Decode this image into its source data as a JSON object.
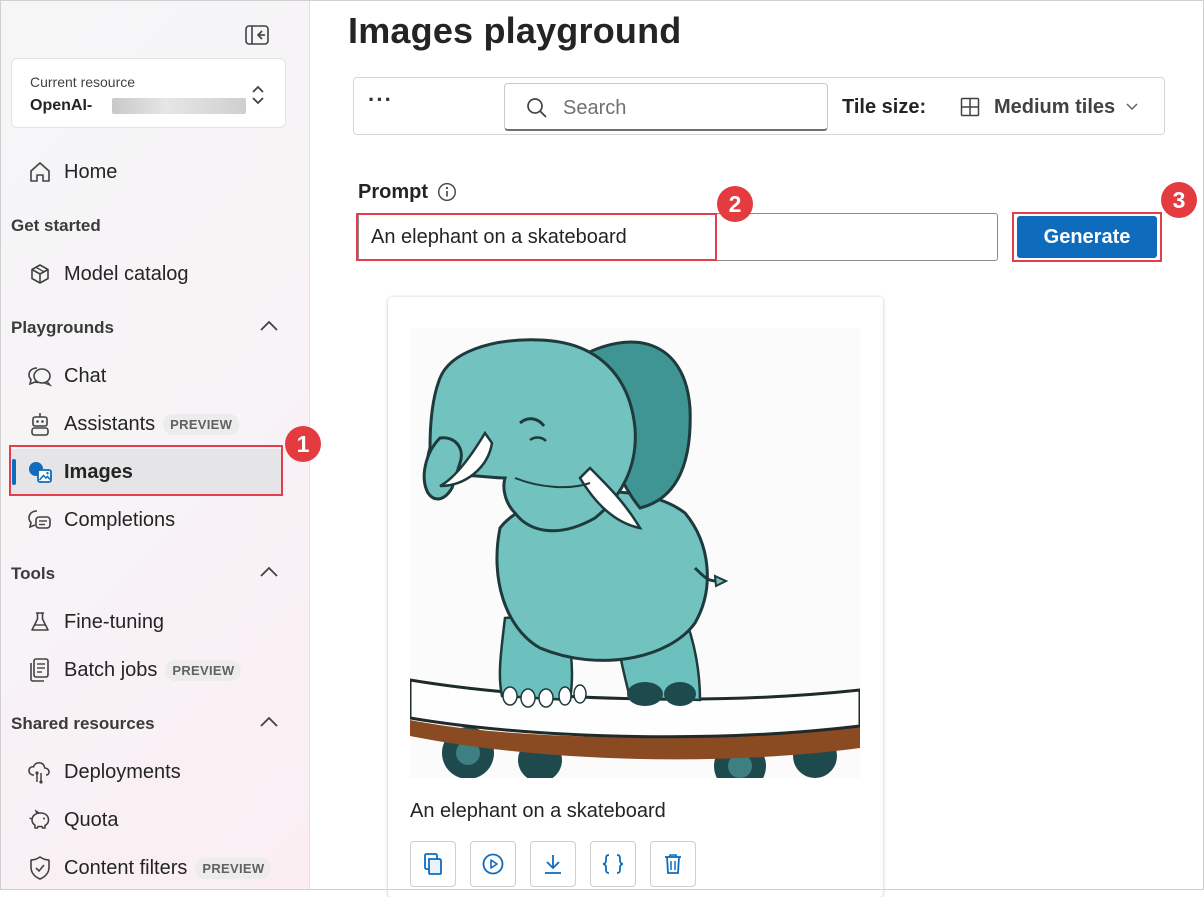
{
  "sidebar": {
    "resource": {
      "label": "Current resource",
      "name": "OpenAI-"
    },
    "home": "Home",
    "sections": {
      "get_started": "Get started",
      "playgrounds": "Playgrounds",
      "tools": "Tools",
      "shared_resources": "Shared resources"
    },
    "items": {
      "model_catalog": "Model catalog",
      "chat": "Chat",
      "assistants": "Assistants",
      "images": "Images",
      "completions": "Completions",
      "fine_tuning": "Fine-tuning",
      "batch_jobs": "Batch jobs",
      "deployments": "Deployments",
      "quota": "Quota",
      "content_filters": "Content filters"
    },
    "preview_badge": "PREVIEW"
  },
  "main": {
    "title": "Images playground",
    "toolbar": {
      "more": "···",
      "search_placeholder": "Search",
      "tile_size_label": "Tile size:",
      "tile_size_value": "Medium tiles"
    },
    "prompt": {
      "label": "Prompt",
      "value": "An elephant on a skateboard"
    },
    "generate_label": "Generate",
    "result": {
      "caption": "An elephant on a skateboard"
    }
  },
  "annotations": {
    "step1": "1",
    "step2": "2",
    "step3": "3"
  },
  "colors": {
    "accent": "#0f6cbd",
    "highlight": "#e43d4d",
    "step_badge": "#e33b3f"
  }
}
